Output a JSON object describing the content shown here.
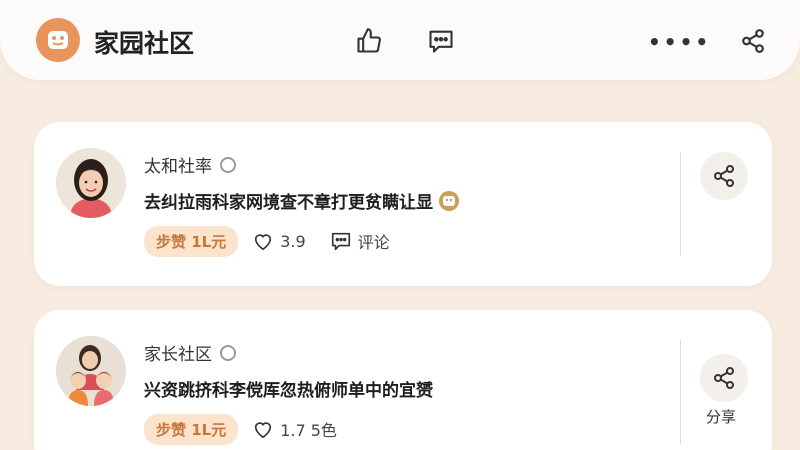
{
  "header": {
    "title": "家园社区",
    "more_label": "••••",
    "icons": [
      "logo-icon",
      "thumbs-up-icon",
      "comment-icon",
      "more-icon",
      "share-icon"
    ]
  },
  "posts": [
    {
      "author": "太和社率",
      "text": "去纠拉雨科家网境查不章打更贫瞒让显",
      "tag": "步赞 1L元",
      "likes": "3.9",
      "comment_label": "评论"
    },
    {
      "author": "家长社区",
      "text": "兴资跳挤科李傥厍忽热俯师单中的宜赟",
      "tag": "步赞 1L元",
      "likes": "1.7 5色",
      "share_label": "分享"
    }
  ],
  "colors": {
    "background": "#f8ece0",
    "logo": "#e7955c",
    "tag_bg": "#fbe3cc",
    "tag_text": "#c9763a"
  }
}
